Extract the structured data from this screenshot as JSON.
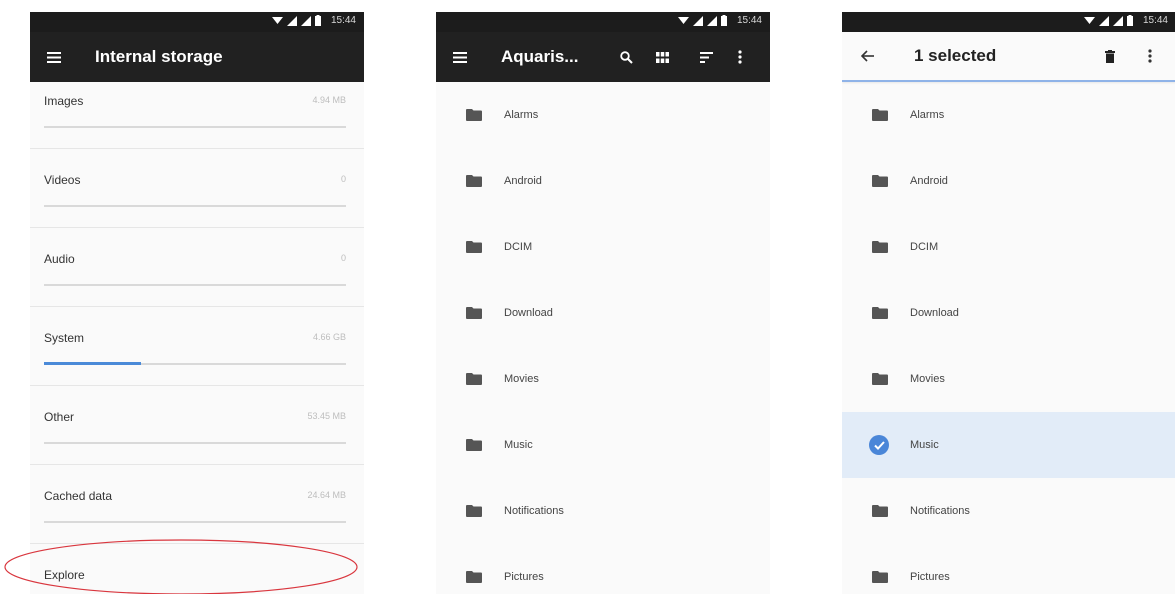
{
  "status_bar": {
    "time": "15:44"
  },
  "screen1": {
    "title": "Internal storage",
    "items": [
      {
        "label": "Images",
        "value": "4.94 MB",
        "fill": 0
      },
      {
        "label": "Videos",
        "value": "0",
        "fill": 0
      },
      {
        "label": "Audio",
        "value": "0",
        "fill": 0
      },
      {
        "label": "System",
        "value": "4.66 GB",
        "fill": 0.32
      },
      {
        "label": "Other",
        "value": "53.45 MB",
        "fill": 0
      },
      {
        "label": "Cached data",
        "value": "24.64 MB",
        "fill": 0
      }
    ],
    "explore_label": "Explore",
    "highlight_color": "#d9363e"
  },
  "screen2": {
    "title": "Aquaris...",
    "folders": [
      "Alarms",
      "Android",
      "DCIM",
      "Download",
      "Movies",
      "Music",
      "Notifications",
      "Pictures"
    ]
  },
  "screen3": {
    "title": "1 selected",
    "folders": [
      "Alarms",
      "Android",
      "DCIM",
      "Download",
      "Movies",
      "Music",
      "Notifications",
      "Pictures"
    ],
    "selected_folder": "Music"
  },
  "icons": {
    "menu": "hamburger-menu-icon",
    "search": "search-icon",
    "grid": "grid-view-icon",
    "sort": "sort-icon",
    "more": "more-vert-icon",
    "back": "arrow-back-icon",
    "delete": "trash-icon",
    "folder": "folder-icon",
    "check": "check-circle-icon"
  },
  "colors": {
    "appbar_dark": "#212121",
    "accent_blue": "#4a8ad8",
    "selected_row": "#e2ecf8"
  }
}
